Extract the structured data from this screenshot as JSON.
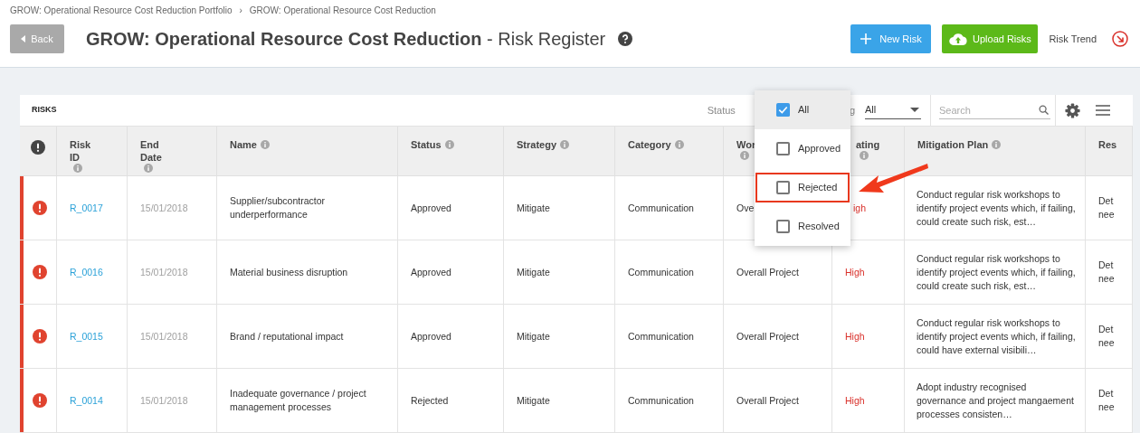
{
  "breadcrumbs": [
    "GROW: Operational Resource Cost Reduction Portfolio",
    "GROW: Operational Resource Cost Reduction"
  ],
  "breadcrumb_separator": "›",
  "back_button": "Back",
  "title": {
    "project": "GROW: Operational Resource Cost Reduction",
    "suffix": "- Risk Register"
  },
  "actions": {
    "new_risk": "New Risk",
    "upload": "Upload Risks",
    "trend": "Risk Trend"
  },
  "panel": {
    "title": "RISKS",
    "status_label": "Status",
    "rating_label": "g",
    "rating_value": "All",
    "search_placeholder": "Search"
  },
  "status_dropdown": [
    {
      "label": "All",
      "checked": true,
      "highlighted": false
    },
    {
      "label": "Approved",
      "checked": false,
      "highlighted": false
    },
    {
      "label": "Rejected",
      "checked": false,
      "highlighted": true
    },
    {
      "label": "Resolved",
      "checked": false,
      "highlighted": false
    }
  ],
  "columns": [
    {
      "label": "Risk ID",
      "info": true
    },
    {
      "label": "End Date",
      "info": true
    },
    {
      "label": "Name",
      "info": true
    },
    {
      "label": "Status",
      "info": true
    },
    {
      "label": "Strategy",
      "info": true
    },
    {
      "label": "Category",
      "info": true
    },
    {
      "label": "Wor",
      "info": true
    },
    {
      "label": "ating",
      "info": true
    },
    {
      "label": "Mitigation Plan",
      "info": true
    },
    {
      "label": "Res",
      "info": false
    }
  ],
  "rows": [
    {
      "alert": true,
      "cells": [
        "R_0017",
        "15/01/2018",
        "Supplier/subcontractor underperformance",
        "Approved",
        "Mitigate",
        "Communication",
        "Ove",
        "igh",
        "Conduct regular risk workshops to identify project events which, if failing, could create such risk, est…",
        "Det nee"
      ]
    },
    {
      "alert": true,
      "cells": [
        "R_0016",
        "15/01/2018",
        "Material business disruption",
        "Approved",
        "Mitigate",
        "Communication",
        "Overall Project",
        "High",
        "Conduct regular risk workshops to identify project events which, if failing, could create such risk, est…",
        "Det nee"
      ]
    },
    {
      "alert": true,
      "cells": [
        "R_0015",
        "15/01/2018",
        "Brand / reputational impact",
        "Approved",
        "Mitigate",
        "Communication",
        "Overall Project",
        "High",
        "Conduct regular risk workshops to identify project events which, if failing, could have external visibili…",
        "Det nee"
      ]
    },
    {
      "alert": true,
      "cells": [
        "R_0014",
        "15/01/2018",
        "Inadequate governance / project management processes",
        "Rejected",
        "Mitigate",
        "Communication",
        "Overall Project",
        "High",
        "Adopt industry recognised governance and project mangaement processes consisten…",
        "Det nee"
      ]
    }
  ]
}
